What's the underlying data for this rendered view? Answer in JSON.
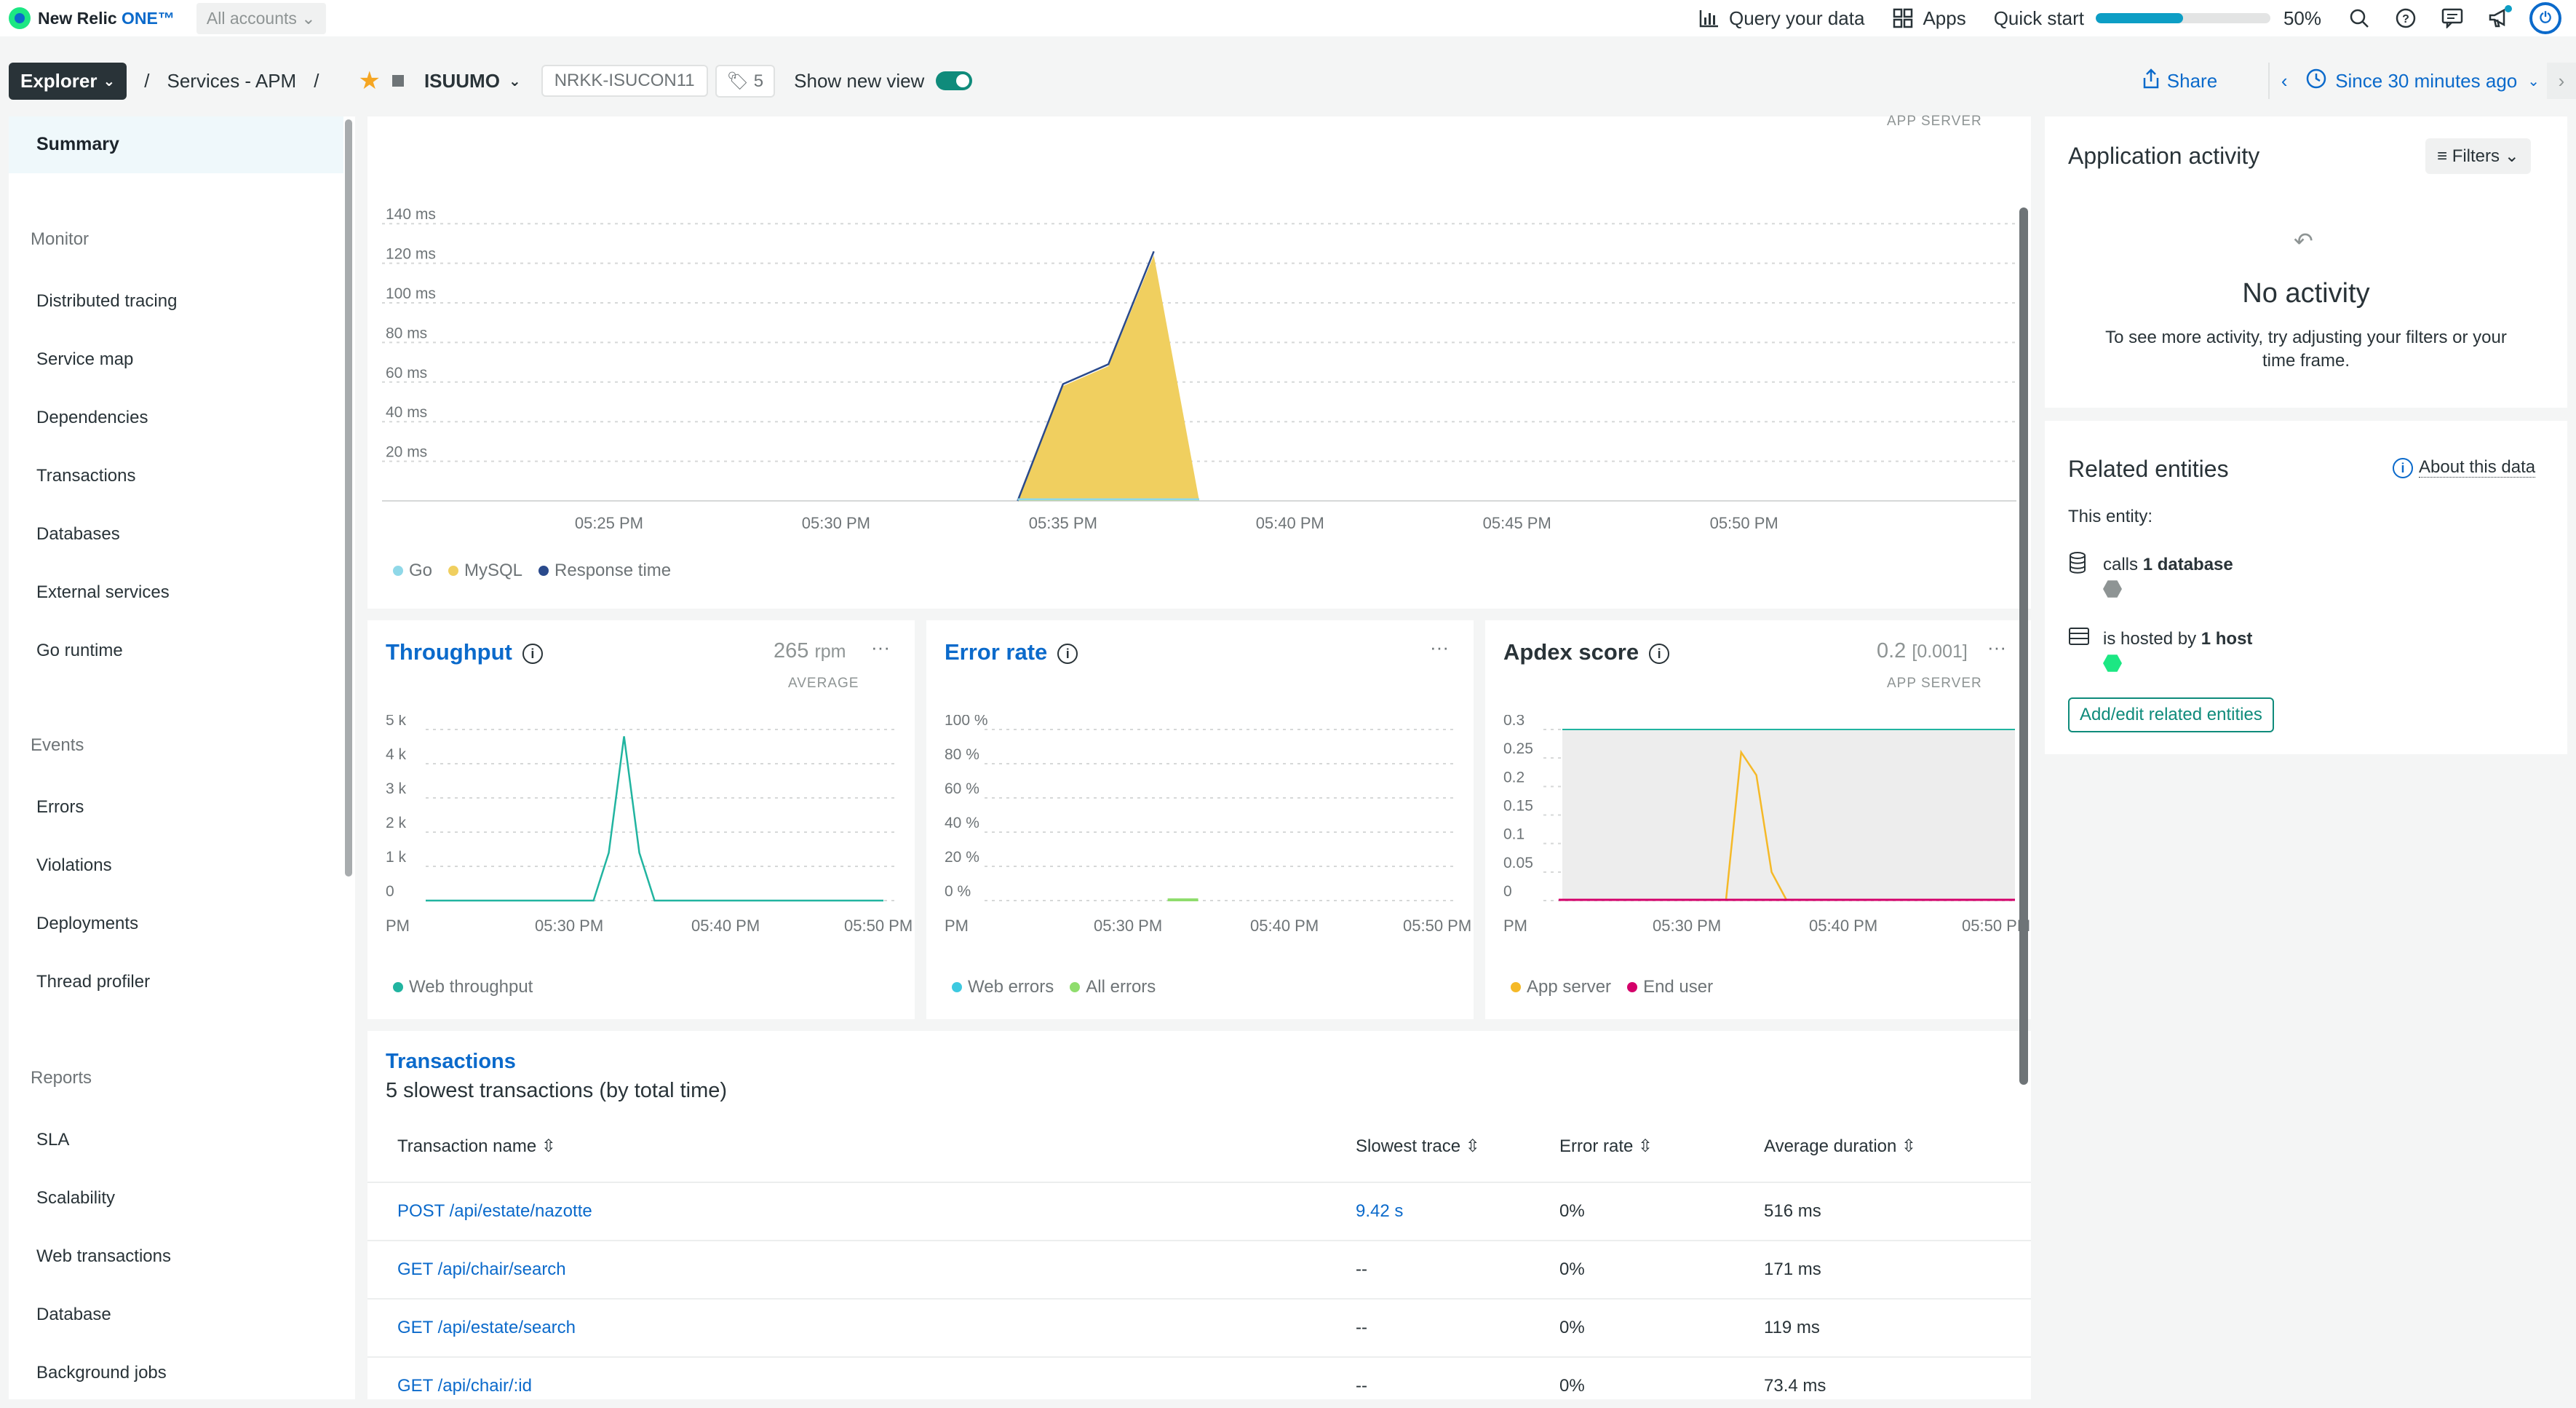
{
  "topbar": {
    "logo_text": "New Relic",
    "logo_one": "ONE™",
    "account_selector": "All accounts",
    "query_label": "Query your data",
    "apps_label": "Apps",
    "quickstart_label": "Quick start",
    "quickstart_progress": 0.5,
    "quickstart_percent": "50%"
  },
  "breadcrumb": {
    "explorer": "Explorer",
    "services": "Services - APM",
    "entity": "ISUUMO",
    "account_chip": "NRKK-ISUCON11",
    "tag_count": "5",
    "new_view_label": "Show new view",
    "share_label": "Share",
    "time_range": "Since 30 minutes ago"
  },
  "sidebar": {
    "active": "Summary",
    "groups": [
      {
        "label": "Monitor",
        "items": [
          "Distributed tracing",
          "Service map",
          "Dependencies",
          "Transactions",
          "Databases",
          "External services",
          "Go runtime"
        ]
      },
      {
        "label": "Events",
        "items": [
          "Errors",
          "Violations",
          "Deployments",
          "Thread profiler"
        ]
      },
      {
        "label": "Reports",
        "items": [
          "SLA",
          "Scalability",
          "Web transactions",
          "Database",
          "Background jobs"
        ]
      }
    ]
  },
  "colors": {
    "go": "#8fd8e8",
    "mysql": "#f0cf5f",
    "response_line": "#2a4a8c",
    "throughput": "#21b4a0",
    "web_errors": "#3dc9e0",
    "all_errors": "#8fdd6d",
    "app_server": "#f5b928",
    "end_user": "#d4006a",
    "accent": "#0b6acb"
  },
  "response_chart": {
    "top_label": "APP SERVER",
    "legend": [
      "Go",
      "MySQL",
      "Response time"
    ],
    "chart_data": {
      "type": "area",
      "y_ticks": [
        "140 ms",
        "120 ms",
        "100 ms",
        "80 ms",
        "60 ms",
        "40 ms",
        "20 ms"
      ],
      "x_ticks": [
        "05:25 PM",
        "05:30 PM",
        "05:35 PM",
        "05:40 PM",
        "05:45 PM",
        "05:50 PM"
      ],
      "ylim": [
        0,
        150
      ],
      "unit": "ms",
      "series": [
        {
          "name": "MySQL",
          "points": [
            [
              "05:34 PM",
              0
            ],
            [
              "05:35 PM",
              58
            ],
            [
              "05:36 PM",
              68
            ],
            [
              "05:37 PM",
              124
            ],
            [
              "05:38 PM",
              0
            ]
          ]
        },
        {
          "name": "Response time",
          "points": [
            [
              "05:34 PM",
              0
            ],
            [
              "05:35 PM",
              59
            ],
            [
              "05:36 PM",
              69
            ],
            [
              "05:37 PM",
              126
            ],
            [
              "05:38 PM",
              0
            ]
          ]
        },
        {
          "name": "Go",
          "points": [
            [
              "05:34 PM",
              0
            ],
            [
              "05:38 PM",
              0
            ]
          ]
        }
      ]
    }
  },
  "throughput": {
    "title": "Throughput",
    "value": "265",
    "unit": "rpm",
    "sub": "AVERAGE",
    "legend": [
      "Web throughput"
    ],
    "chart_data": {
      "type": "line",
      "y_ticks": [
        "5 k",
        "4 k",
        "3 k",
        "2 k",
        "1 k",
        "0"
      ],
      "x_ticks": [
        "PM",
        "05:30 PM",
        "05:40 PM",
        "05:50 PM"
      ],
      "ylim": [
        0,
        5000
      ],
      "series": [
        {
          "name": "Web throughput",
          "points": [
            [
              "05:23 PM",
              0
            ],
            [
              "05:34 PM",
              0
            ],
            [
              "05:35 PM",
              1400
            ],
            [
              "05:36 PM",
              4800
            ],
            [
              "05:37 PM",
              1400
            ],
            [
              "05:38 PM",
              0
            ],
            [
              "05:53 PM",
              0
            ]
          ]
        }
      ]
    }
  },
  "error_rate": {
    "title": "Error rate",
    "legend": [
      "Web errors",
      "All errors"
    ],
    "chart_data": {
      "type": "line",
      "y_ticks": [
        "100 %",
        "80 %",
        "60 %",
        "40 %",
        "20 %",
        "0 %"
      ],
      "x_ticks": [
        "PM",
        "05:30 PM",
        "05:40 PM",
        "05:50 PM"
      ],
      "ylim": [
        0,
        100
      ],
      "series": [
        {
          "name": "All errors",
          "points": [
            [
              "05:35 PM",
              0
            ],
            [
              "05:37 PM",
              0
            ]
          ]
        }
      ]
    }
  },
  "apdex": {
    "title": "Apdex score",
    "value": "0.2",
    "value_detail": "[0.001]",
    "sub": "APP SERVER",
    "legend": [
      "App server",
      "End user"
    ],
    "chart_data": {
      "type": "line",
      "y_ticks": [
        "0.3",
        "0.25",
        "0.2",
        "0.15",
        "0.1",
        "0.05",
        "0"
      ],
      "x_ticks": [
        "PM",
        "05:30 PM",
        "05:40 PM",
        "05:50 PM"
      ],
      "ylim": [
        0,
        0.3
      ],
      "series": [
        {
          "name": "App server",
          "points": [
            [
              "05:35 PM",
              0
            ],
            [
              "05:36 PM",
              0.26
            ],
            [
              "05:37 PM",
              0.22
            ],
            [
              "05:38 PM",
              0.05
            ],
            [
              "05:39 PM",
              0
            ]
          ]
        },
        {
          "name": "End user",
          "points": [
            [
              "05:26 PM",
              0
            ],
            [
              "05:54 PM",
              0
            ]
          ]
        }
      ]
    }
  },
  "transactions": {
    "title": "Transactions",
    "subtitle": "5 slowest transactions (by total time)",
    "columns": [
      "Transaction name",
      "Slowest trace",
      "Error rate",
      "Average duration"
    ],
    "rows": [
      {
        "name": "POST /api/estate/nazotte",
        "trace": "9.42 s",
        "error": "0%",
        "duration": "516 ms"
      },
      {
        "name": "GET /api/chair/search",
        "trace": "--",
        "error": "0%",
        "duration": "171 ms"
      },
      {
        "name": "GET /api/estate/search",
        "trace": "--",
        "error": "0%",
        "duration": "119 ms"
      },
      {
        "name": "GET /api/chair/:id",
        "trace": "--",
        "error": "0%",
        "duration": "73.4 ms"
      }
    ]
  },
  "activity": {
    "title": "Application activity",
    "filters_label": "Filters",
    "empty_title": "No activity",
    "empty_text": "To see more activity, try adjusting your filters or your time frame."
  },
  "related": {
    "title": "Related entities",
    "about_label": "About this data",
    "this_entity": "This entity:",
    "calls_prefix": "calls",
    "calls_target": "1 database",
    "hosted_prefix": "is hosted by",
    "hosted_target": "1 host",
    "add_edit_label": "Add/edit related entities"
  }
}
